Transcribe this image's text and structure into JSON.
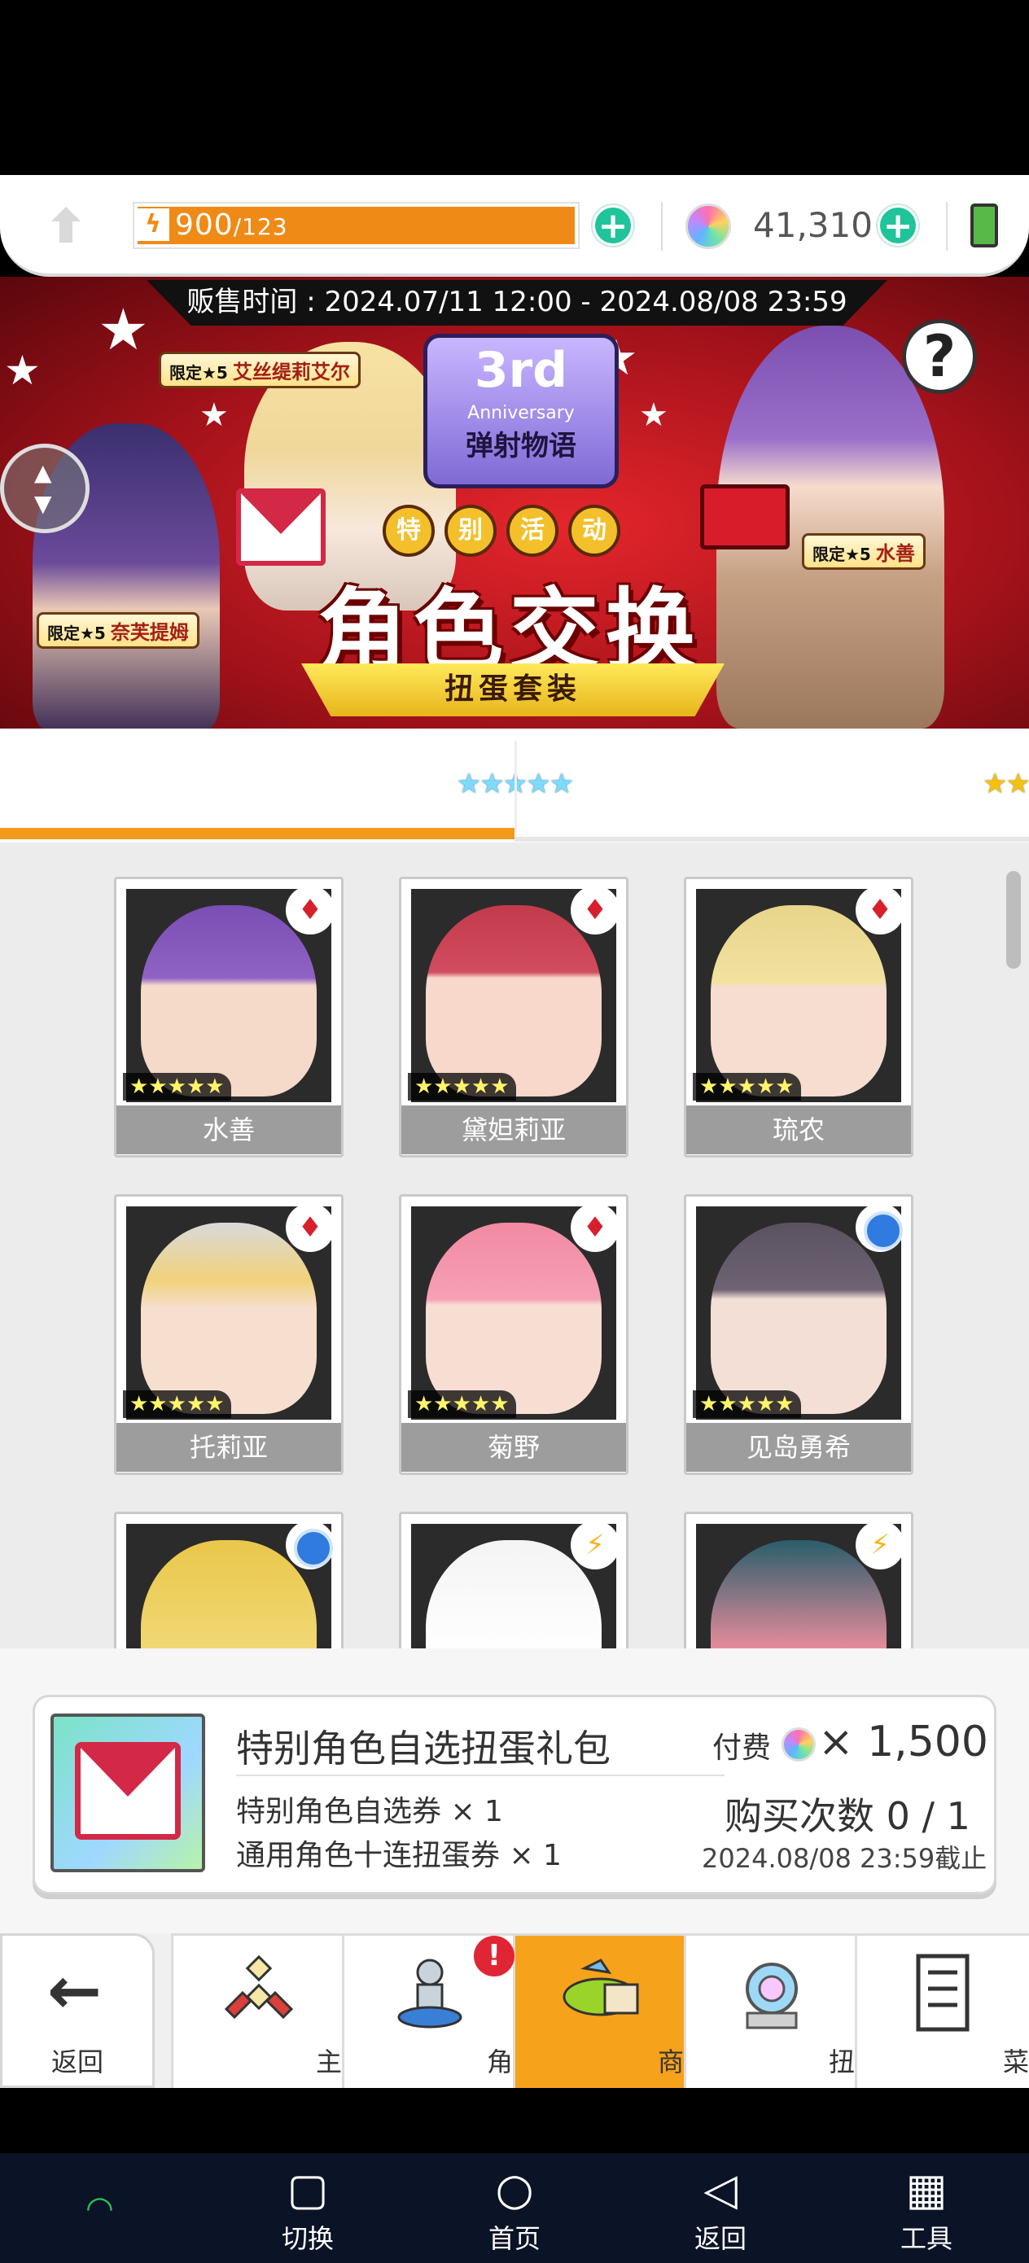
{
  "resources": {
    "stamina_value": "900",
    "stamina_max": "/123",
    "stamina_fill": 1.0,
    "gems": "41,310",
    "add_symbol": "+"
  },
  "banner": {
    "sale_time": "贩售时间 : 2024.07/11 12:00 - 2024.08/08 23:59",
    "tag_a": {
      "prefix": "限定★5",
      "name": "奈芙提姆"
    },
    "tag_b": {
      "prefix": "限定★5",
      "name": "艾丝缇莉艾尔"
    },
    "tag_c": {
      "prefix": "限定★5",
      "name": "水善"
    },
    "logo_top": "3rd",
    "logo_mid": "Anniversary",
    "logo_bottom": "弹射物语",
    "special_chars": [
      "特",
      "别",
      "活",
      "动"
    ],
    "headline": "角色交换",
    "subline": "扭蛋套装",
    "help": "?"
  },
  "tabs": [
    {
      "stars": "★★★★★",
      "active": true
    },
    {
      "stars": "★★★★",
      "active": false
    }
  ],
  "characters": [
    {
      "name": "水善",
      "stars": "★★★★★",
      "badge": "red"
    },
    {
      "name": "黛妲莉亚",
      "stars": "★★★★★",
      "badge": "red"
    },
    {
      "name": "琉农",
      "stars": "★★★★★",
      "badge": "red"
    },
    {
      "name": "托莉亚",
      "stars": "★★★★★",
      "badge": "red"
    },
    {
      "name": "菊野",
      "stars": "★★★★★",
      "badge": "red"
    },
    {
      "name": "见岛勇希",
      "stars": "★★★★★",
      "badge": "blue"
    },
    {
      "name": "",
      "stars": "",
      "badge": "blue"
    },
    {
      "name": "",
      "stars": "",
      "badge": "bolt"
    },
    {
      "name": "",
      "stars": "",
      "badge": "bolt"
    }
  ],
  "purchase": {
    "title": "特别角色自选扭蛋礼包",
    "item1": "特别角色自选券 × 1",
    "item2": "通用角色十连扭蛋券 × 1",
    "fee_label": "付费",
    "price": "× 1,500",
    "buy_count": "购买次数 0 / 1",
    "deadline": "2024.08/08 23:59截止"
  },
  "nav": {
    "back": "返回",
    "items": [
      "主城",
      "角色",
      "商店",
      "扭蛋",
      "菜单"
    ],
    "alert": "!"
  },
  "system_nav": [
    "切换",
    "首页",
    "返回",
    "工具"
  ],
  "colors": {
    "accent": "#f39a1b",
    "stamina": "#f08a17",
    "add": "#1fc49a",
    "banner": "#c5141c"
  }
}
